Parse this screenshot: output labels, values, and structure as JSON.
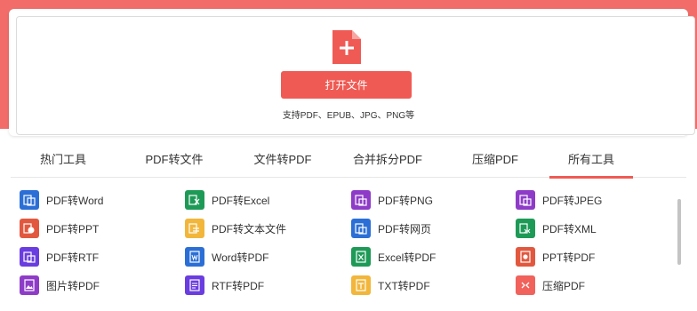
{
  "upload": {
    "open_button_label": "打开文件",
    "supported_formats": "支持PDF、EPUB、JPG、PNG等"
  },
  "tabs": [
    {
      "label": "热门工具"
    },
    {
      "label": "PDF转文件"
    },
    {
      "label": "文件转PDF"
    },
    {
      "label": "合并拆分PDF"
    },
    {
      "label": "压缩PDF"
    },
    {
      "label": "所有工具",
      "active": true
    }
  ],
  "tools": [
    {
      "label": "PDF转Word",
      "icon": "word-doc-icon",
      "color": "#2b6fd6"
    },
    {
      "label": "PDF转Excel",
      "icon": "excel-doc-icon",
      "color": "#1e9a57"
    },
    {
      "label": "PDF转PNG",
      "icon": "png-image-icon",
      "color": "#8e3cc8"
    },
    {
      "label": "PDF转JPEG",
      "icon": "jpeg-image-icon",
      "color": "#8e3cc8"
    },
    {
      "label": "PDF转PPT",
      "icon": "ppt-doc-icon",
      "color": "#e2583e"
    },
    {
      "label": "PDF转文本文件",
      "icon": "txt-doc-icon",
      "color": "#f2b63b"
    },
    {
      "label": "PDF转网页",
      "icon": "html-doc-icon",
      "color": "#2b6fd6"
    },
    {
      "label": "PDF转XML",
      "icon": "xml-doc-icon",
      "color": "#1e9a57"
    },
    {
      "label": "PDF转RTF",
      "icon": "rtf-doc-icon",
      "color": "#6a3de0"
    },
    {
      "label": "Word转PDF",
      "icon": "word-to-pdf-icon",
      "color": "#2b6fd6"
    },
    {
      "label": "Excel转PDF",
      "icon": "excel-to-pdf-icon",
      "color": "#1e9a57"
    },
    {
      "label": "PPT转PDF",
      "icon": "ppt-to-pdf-icon",
      "color": "#e2583e"
    },
    {
      "label": "图片转PDF",
      "icon": "image-to-pdf-icon",
      "color": "#8e3cc8"
    },
    {
      "label": "RTF转PDF",
      "icon": "rtf-to-pdf-icon",
      "color": "#6a3de0"
    },
    {
      "label": "TXT转PDF",
      "icon": "txt-to-pdf-icon",
      "color": "#f2b63b"
    },
    {
      "label": "压缩PDF",
      "icon": "compress-pdf-icon",
      "color": "#f0625b"
    }
  ],
  "colors": {
    "accent": "#ef5b54",
    "band": "#f26d6a"
  }
}
